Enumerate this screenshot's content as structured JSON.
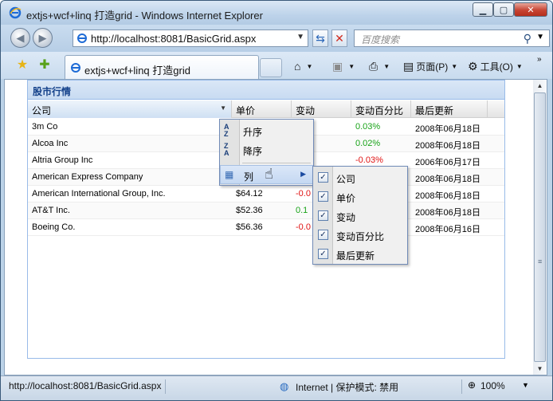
{
  "window": {
    "title": "extjs+wcf+linq 打造grid - Windows Internet Explorer"
  },
  "address": {
    "url": "http://localhost:8081/BasicGrid.aspx"
  },
  "search": {
    "placeholder": "百度搜索"
  },
  "tab": {
    "title": "extjs+wcf+linq 打造grid"
  },
  "toolbar": {
    "page": "页面(P)",
    "tools": "工具(O)"
  },
  "panel": {
    "title": "股市行情"
  },
  "grid": {
    "columns": [
      "公司",
      "单价",
      "变动",
      "变动百分比",
      "最后更新"
    ],
    "rows": [
      {
        "company": "3m Co",
        "price": "",
        "change": "",
        "pct": "0.03%",
        "updated": "2008年06月18日"
      },
      {
        "company": "Alcoa Inc",
        "price": "",
        "change": "",
        "pct": "0.02%",
        "updated": "2008年06月18日"
      },
      {
        "company": "Altria Group Inc",
        "price": "",
        "change": "",
        "pct": "-0.03%",
        "updated": "2006年06月17日"
      },
      {
        "company": "American Express Company",
        "price": "",
        "change": "",
        "pct": "",
        "updated": "2008年06月18日"
      },
      {
        "company": "American International Group, Inc.",
        "price": "$64.12",
        "change": "-0.0",
        "pct": "",
        "updated": "2008年06月18日"
      },
      {
        "company": "AT&T Inc.",
        "price": "$52.36",
        "change": "0.1",
        "pct": "",
        "updated": "2008年06月18日"
      },
      {
        "company": "Boeing Co.",
        "price": "$56.36",
        "change": "-0.0",
        "pct": "",
        "updated": "2008年06月16日"
      }
    ]
  },
  "header_menu": {
    "asc": "升序",
    "desc": "降序",
    "columns": "列"
  },
  "columns_menu": {
    "items": [
      "公司",
      "单价",
      "变动",
      "变动百分比",
      "最后更新"
    ]
  },
  "status": {
    "text": "http://localhost:8081/BasicGrid.aspx",
    "zone": "Internet | 保护模式: 禁用",
    "zoom": "100%"
  }
}
